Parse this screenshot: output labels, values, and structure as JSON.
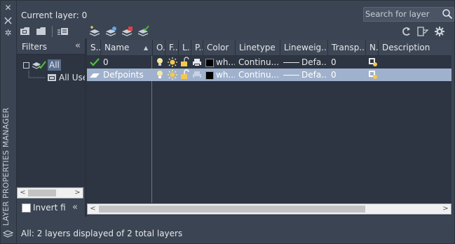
{
  "window": {
    "palette_title": "LAYER PROPERTIES MANAGER",
    "strip_icons": [
      "close-icon",
      "auto-hide-icon",
      "properties-icon",
      "layers-icon"
    ]
  },
  "header": {
    "current_layer_label": "Current layer: 0",
    "search_placeholder": "Search for layer"
  },
  "toolbar": {
    "left_icons": [
      "new-property-filter-icon",
      "new-group-filter-icon",
      "layer-states-manager-icon"
    ],
    "layer_icons": [
      "new-layer-icon",
      "new-layer-vp-frozen-icon",
      "delete-layer-icon",
      "set-current-icon"
    ],
    "right_icons": [
      "refresh-icon",
      "settings-toggle-icon",
      "gear-icon"
    ]
  },
  "filters": {
    "title": "Filters",
    "tree": {
      "root_label": "All",
      "child_label": "All Used Layers"
    },
    "invert_label": "Invert filter",
    "invert_checked": false
  },
  "grid": {
    "columns": [
      "S..",
      "Name",
      "O..",
      "F..",
      "L..",
      "P..",
      "Color",
      "Linetype",
      "Lineweig...",
      "Transp...",
      "N..",
      "Description"
    ],
    "sort_column": "Name",
    "rows": [
      {
        "status": "current",
        "name": "0",
        "on": "bulb-on-icon",
        "freeze": "sun-icon",
        "lock": "unlocked-icon",
        "plot": "printer-icon",
        "color_label": "wh...",
        "color_hex": "#000000",
        "linetype": "Continu...",
        "lineweight": "Defa...",
        "transparency": "0",
        "new_vp_freeze": "new-vp-freeze-icon",
        "description": "",
        "selected": false
      },
      {
        "status": "layer",
        "name": "Defpoints",
        "on": "bulb-on-icon",
        "freeze": "sun-icon",
        "lock": "unlocked-icon",
        "plot": "no-plot-icon",
        "color_label": "wh...",
        "color_hex": "#000000",
        "linetype": "Continu...",
        "lineweight": "Defa...",
        "transparency": "0",
        "new_vp_freeze": "new-vp-freeze-icon",
        "description": "",
        "selected": true
      }
    ]
  },
  "status_bar": {
    "text": "All: 2 layers displayed of 2 total layers"
  },
  "colors": {
    "panel_bg": "#3b4453",
    "grid_bg": "#2d3542",
    "selection": "#9fb1cc",
    "tree_selection": "#5b6e8f",
    "accent_green": "#4fbf3a",
    "icon_yellow": "#f2c94c"
  }
}
